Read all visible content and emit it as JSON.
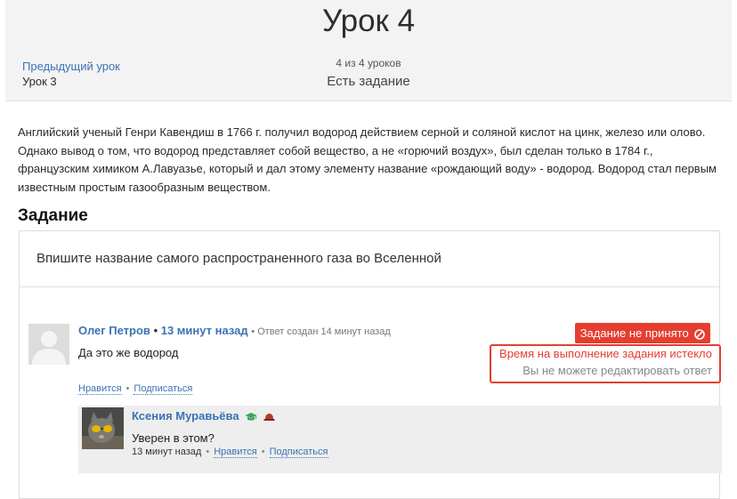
{
  "header": {
    "title": "Урок 4",
    "prev_link": "Предыдущий урок",
    "prev_name": "Урок 3",
    "progress": "4 из 4 уроков",
    "status": "Есть задание"
  },
  "content": {
    "paragraph": "Английский ученый Генри Кавендиш в 1766 г. получил водород действием серной и соляной кислот на цинк, железо или олово. Однако вывод о том, что водород представляет собой вещество, а не «горючий воздух», был сделан только в 1784 г., французским химиком А.Лавуазье, который и дал этому элементу название «рождающий воду» - водород. Водород стал первым известным простым газообразным веществом."
  },
  "task": {
    "heading": "Задание",
    "question": "Впишите название самого распространенного газа во Вселенной"
  },
  "answer": {
    "author": "Олег Петров",
    "time": "13 минут назад",
    "meta": "Ответ создан 14 минут назад",
    "text": "Да это же водород",
    "status_badge": "Задание не принято",
    "expired": "Время на выполнение задания истекло",
    "no_edit": "Вы не можете редактировать ответ",
    "like": "Нравится",
    "subscribe": "Подписаться",
    "status_color": "#e53e30"
  },
  "reply": {
    "author": "Ксения Муравьёва",
    "text": "Уверен в этом?",
    "time": "13 минут назад",
    "like": "Нравится",
    "subscribe": "Подписаться"
  },
  "icons": {
    "reject": "cancel-circle-icon",
    "author_badge_1": "graduation-cap-icon",
    "author_badge_2": "hat-icon"
  }
}
